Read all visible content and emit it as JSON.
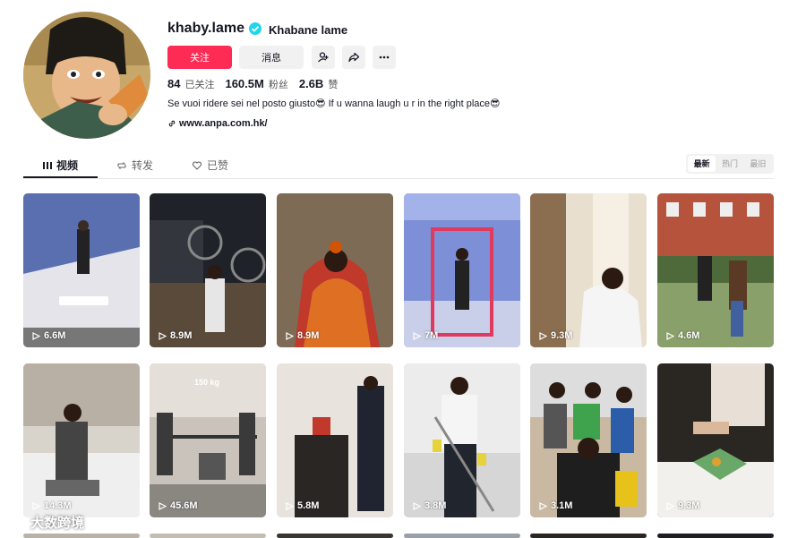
{
  "profile": {
    "username": "khaby.lame",
    "nickname": "Khabane lame",
    "follow_label": "关注",
    "message_label": "消息",
    "stats": {
      "following": "84",
      "following_label": "已关注",
      "followers": "160.5M",
      "followers_label": "粉丝",
      "likes": "2.6B",
      "likes_label": "赞"
    },
    "bio": "Se vuoi ridere sei nel posto giusto😎 If u wanna laugh u r in the right place😎",
    "link": "www.anpa.com.hk/"
  },
  "tabs": [
    {
      "label": "视频"
    },
    {
      "label": "转发"
    },
    {
      "label": "已赞"
    }
  ],
  "sort": [
    "最新",
    "热门",
    "最旧"
  ],
  "videos": [
    {
      "views": "6.6M",
      "caption": ""
    },
    {
      "views": "8.9M",
      "caption": ""
    },
    {
      "views": "8.9M",
      "caption": ""
    },
    {
      "views": "7M",
      "caption": ""
    },
    {
      "views": "9.3M",
      "caption": ""
    },
    {
      "views": "4.6M",
      "caption": ""
    },
    {
      "views": "14.3M",
      "caption": ""
    },
    {
      "views": "45.6M",
      "caption": "150 kg"
    },
    {
      "views": "5.8M",
      "caption": ""
    },
    {
      "views": "3.8M",
      "caption": ""
    },
    {
      "views": "3.1M",
      "caption": ""
    },
    {
      "views": "9.3M",
      "caption": ""
    }
  ],
  "watermark": "大数跨境",
  "colors": {
    "accent": "#fe2c55",
    "verified": "#20d5ec"
  }
}
